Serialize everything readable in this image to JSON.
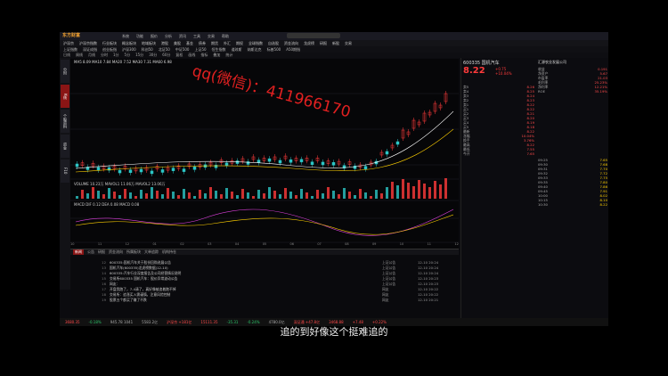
{
  "app": {
    "logo": "东方财富",
    "menu": [
      "系统",
      "功能",
      "报价",
      "分析",
      "资讯",
      "工具",
      "交易",
      "帮助"
    ],
    "search_placeholder": "代码/名称/拼音"
  },
  "menubar1": [
    "沪深京",
    "沪深京指数",
    "行业板块",
    "概念板块",
    "地域板块",
    "港股",
    "美股",
    "基金",
    "债券",
    "期货",
    "外汇",
    "期权",
    "全球指数",
    "自选股",
    "资金流向",
    "龙虎榜",
    "研报",
    "新股",
    "交易"
  ],
  "menubar2": [
    "上证指数",
    "深证成指",
    "创业板指",
    "沪深300",
    "科创50",
    "北证50",
    "中证500",
    "上证50",
    "恒生指数",
    "道琼斯",
    "纳斯达克",
    "标普500",
    "A50期指"
  ],
  "menubar3": [
    "日线",
    "周线",
    "月线",
    "分时",
    "1分",
    "5分",
    "15分",
    "30分",
    "60分",
    "复权",
    "画线",
    "指标",
    "叠加",
    "统计"
  ],
  "left_tabs": [
    "分时",
    "K线",
    "个股资料",
    "资金",
    "F10"
  ],
  "chart": {
    "info_line": "MA5 8.09  MA10 7.84  MA20 7.52  MA30 7.31  MA60 6.98",
    "volume_line": "VOLUME 10.23万  MAVOL1 11.06万  MAVOL2 13.06万",
    "macd_line": "MACD  DIF 0.12  DEA 0.08  MACD 0.08",
    "xticks": [
      "10",
      "11",
      "12",
      "01",
      "02",
      "03",
      "04",
      "05",
      "06",
      "07",
      "08",
      "09",
      "10",
      "11",
      "12"
    ]
  },
  "right": {
    "stock_name": "600335 国机汽车",
    "price": "8.22",
    "change": "+0.75",
    "change_pct": "+10.04%",
    "company": "汇源农业发展公司",
    "quote": [
      {
        "label": "卖5",
        "value": "8.26"
      },
      {
        "label": "卖4",
        "value": "8.25"
      },
      {
        "label": "卖3",
        "value": "8.24"
      },
      {
        "label": "卖2",
        "value": "8.23"
      },
      {
        "label": "卖1",
        "value": "8.22"
      },
      {
        "label": "买1",
        "value": "8.22"
      },
      {
        "label": "买2",
        "value": "8.21"
      },
      {
        "label": "买3",
        "value": "8.20"
      },
      {
        "label": "买4",
        "value": "8.19"
      },
      {
        "label": "买5",
        "value": "8.18"
      },
      {
        "label": "最新",
        "value": "8.22"
      },
      {
        "label": "涨幅",
        "value": "10.04%"
      },
      {
        "label": "换手",
        "value": "3.76%"
      },
      {
        "label": "最高",
        "value": "8.22"
      },
      {
        "label": "最低",
        "value": "7.55"
      },
      {
        "label": "今开",
        "value": "7.65"
      }
    ],
    "f10": [
      {
        "label": "收益",
        "value": "0.191"
      },
      {
        "label": "净资产",
        "value": "5.67"
      },
      {
        "label": "市盈率",
        "value": "21.03"
      },
      {
        "label": "毛利率",
        "value": "25.23%"
      },
      {
        "label": "净利率",
        "value": "12.21%"
      },
      {
        "label": "ROE",
        "value": "35.19%"
      }
    ],
    "trade": [
      {
        "label": "09:25",
        "value": "7.65"
      },
      {
        "label": "09:30",
        "value": "7.68"
      },
      {
        "label": "09:31",
        "value": "7.70"
      },
      {
        "label": "09:32",
        "value": "7.72"
      },
      {
        "label": "09:33",
        "value": "7.75"
      },
      {
        "label": "09:35",
        "value": "7.80"
      },
      {
        "label": "09:40",
        "value": "7.86"
      },
      {
        "label": "09:45",
        "value": "7.91"
      },
      {
        "label": "10:00",
        "value": "8.02"
      },
      {
        "label": "10:15",
        "value": "8.10"
      },
      {
        "label": "10:30",
        "value": "8.22"
      }
    ]
  },
  "bottom": {
    "tabs": [
      "新闻",
      "公告",
      "研报",
      "资金流向",
      "所属板块",
      "大单追踪",
      "机构持仓"
    ],
    "news": [
      {
        "n": "12",
        "t": "600335:国机汽车关于股份回购进展公告",
        "s": "上证公告",
        "d": "12-10 20:24"
      },
      {
        "n": "13",
        "t": "国机汽车(600335)龙虎榜数据(12-10)",
        "s": "上证公告",
        "d": "12-10 20:24"
      },
      {
        "n": "14",
        "t": "600335:汽车行业深度报告及公司经营情况说明",
        "s": "上证公告",
        "d": "12-10 20:24"
      },
      {
        "n": "15",
        "t": "交易所600335 国机汽车：股价异常波动公告",
        "s": "上证公告",
        "d": "12-10 20:23"
      },
      {
        "n": "16",
        "t": "网友：",
        "s": "上证公告",
        "d": "12-10 20:23"
      },
      {
        "n": "17",
        "t": "开盘我跑了，7-4清了，真好像被追着跑不掉",
        "s": "网友",
        "d": "12-10 20:22"
      },
      {
        "n": "18",
        "t": "交易所：追涨买入需谨慎，注意风险控制",
        "s": "网友",
        "d": "12-10 20:22"
      },
      {
        "n": "19",
        "t": "股票五个都买了赚了不跌",
        "s": "网友",
        "d": "12-10 20:21"
      }
    ]
  },
  "statusbar": [
    {
      "text": "3680.35",
      "cls": "up"
    },
    {
      "text": "-0.18%",
      "cls": "dn"
    },
    {
      "text": "945.78 1041",
      "cls": ""
    },
    {
      "text": "5583.2亿",
      "cls": ""
    },
    {
      "text": "沪深京 +181亿",
      "cls": "up"
    },
    {
      "text": "15111.35",
      "cls": "up"
    },
    {
      "text": "-35.31",
      "cls": "dn"
    },
    {
      "text": "-0.24%",
      "cls": "dn"
    },
    {
      "text": "4780.0亿",
      "cls": ""
    },
    {
      "text": "深证通 +47.8亿",
      "cls": "up"
    },
    {
      "text": "3468.88",
      "cls": "up"
    },
    {
      "text": "+7.48",
      "cls": "up"
    },
    {
      "text": "+0.22%",
      "cls": "up"
    }
  ],
  "watermark": "qq(微信)：411966170",
  "subtitle": "追的到好像这个挺难追的"
}
